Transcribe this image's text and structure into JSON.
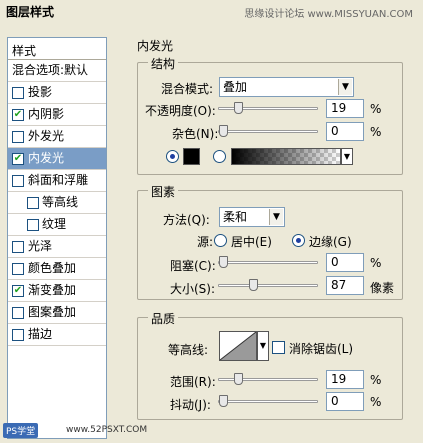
{
  "window": {
    "title": "图层样式",
    "watermark": "思缘设计论坛 www.MISSYUAN.COM"
  },
  "sidebar": {
    "header": "样式",
    "items": [
      {
        "label": "混合选项:默认",
        "checked": null
      },
      {
        "label": "投影",
        "checked": false
      },
      {
        "label": "内阴影",
        "checked": true
      },
      {
        "label": "外发光",
        "checked": false
      },
      {
        "label": "内发光",
        "checked": true,
        "selected": true
      },
      {
        "label": "斜面和浮雕",
        "checked": false
      },
      {
        "label": "等高线",
        "checked": false,
        "sub": true
      },
      {
        "label": "纹理",
        "checked": false,
        "sub": true
      },
      {
        "label": "光泽",
        "checked": false
      },
      {
        "label": "颜色叠加",
        "checked": false
      },
      {
        "label": "渐变叠加",
        "checked": true
      },
      {
        "label": "图案叠加",
        "checked": false
      },
      {
        "label": "描边",
        "checked": false
      }
    ]
  },
  "panel": {
    "title": "内发光",
    "structure": {
      "legend": "结构",
      "blend_label": "混合模式:",
      "blend_value": "叠加",
      "opacity_label": "不透明度(O):",
      "opacity_value": "19",
      "opacity_unit": "%",
      "opacity_level": 19,
      "noise_label": "杂色(N):",
      "noise_value": "0",
      "noise_unit": "%",
      "noise_level": 0,
      "color_mode": "solid",
      "color": "#000000"
    },
    "elements": {
      "legend": "图素",
      "method_label": "方法(Q):",
      "method_value": "柔和",
      "source_label": "源:",
      "source_center": "居中(E)",
      "source_edge": "边缘(G)",
      "source_selected": "edge",
      "choke_label": "阻塞(C):",
      "choke_value": "0",
      "choke_unit": "%",
      "choke_level": 0,
      "size_label": "大小(S):",
      "size_value": "87",
      "size_unit": "像素",
      "size_level": 87
    },
    "quality": {
      "legend": "品质",
      "contour_label": "等高线:",
      "antialias_label": "消除锯齿(L)",
      "antialias_checked": false,
      "range_label": "范围(R):",
      "range_value": "19",
      "range_unit": "%",
      "range_level": 19,
      "jitter_label": "抖动(J):",
      "jitter_value": "0",
      "jitter_unit": "%",
      "jitter_level": 0
    }
  },
  "footer": {
    "logo": "PS学堂",
    "url": "www.52PSXT.COM"
  },
  "colors": {
    "selected_bg": "#7a9dc6",
    "check": "#21a121",
    "panel_bg": "#ece9d8"
  }
}
